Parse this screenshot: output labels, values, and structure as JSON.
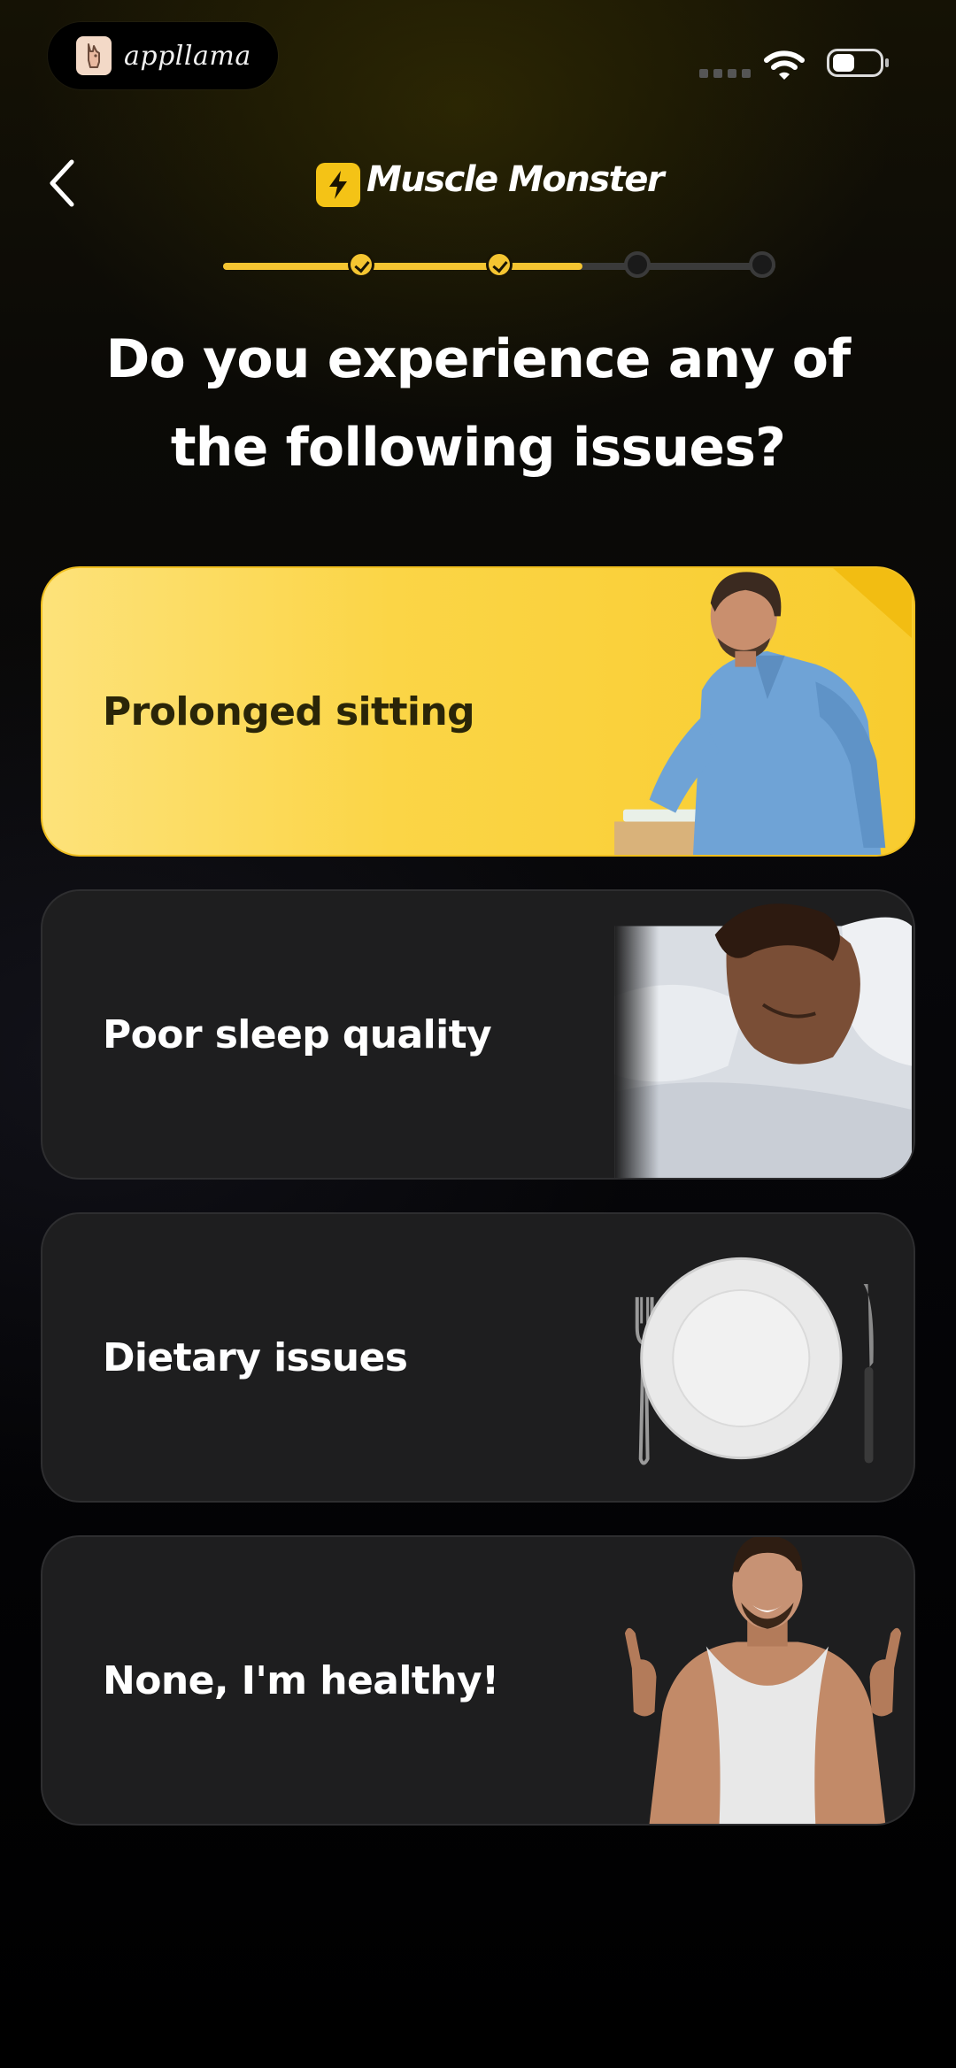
{
  "status_bar": {
    "brand_label": "appllama",
    "icons": [
      "appllama-logo-icon",
      "signal-icon",
      "wifi-icon",
      "battery-icon"
    ]
  },
  "header": {
    "back_icon": "chevron-left-icon",
    "app_name": "Muscle Monster",
    "logo_icon": "lightning-bolt-icon"
  },
  "progress": {
    "total_steps": 5,
    "completed_steps": 2,
    "fill_fraction": 0.65,
    "active_color": "#f5c531",
    "inactive_color": "#3a3a3a"
  },
  "question": {
    "line1": "Do you experience any of",
    "line2": "the following issues?"
  },
  "options": [
    {
      "label": "Prolonged sitting",
      "selected": true,
      "image": "man-sitting-back-pain-photo"
    },
    {
      "label": "Poor sleep quality",
      "selected": false,
      "image": "man-sleeping-photo"
    },
    {
      "label": "Dietary issues",
      "selected": false,
      "image": "empty-plate-fork-knife-photo"
    },
    {
      "label": "None, I'm healthy!",
      "selected": false,
      "image": "man-thumbs-up-photo"
    }
  ],
  "colors": {
    "accent": "#f5c531",
    "card_dark": "#1e1e1f",
    "background": "#000000"
  }
}
